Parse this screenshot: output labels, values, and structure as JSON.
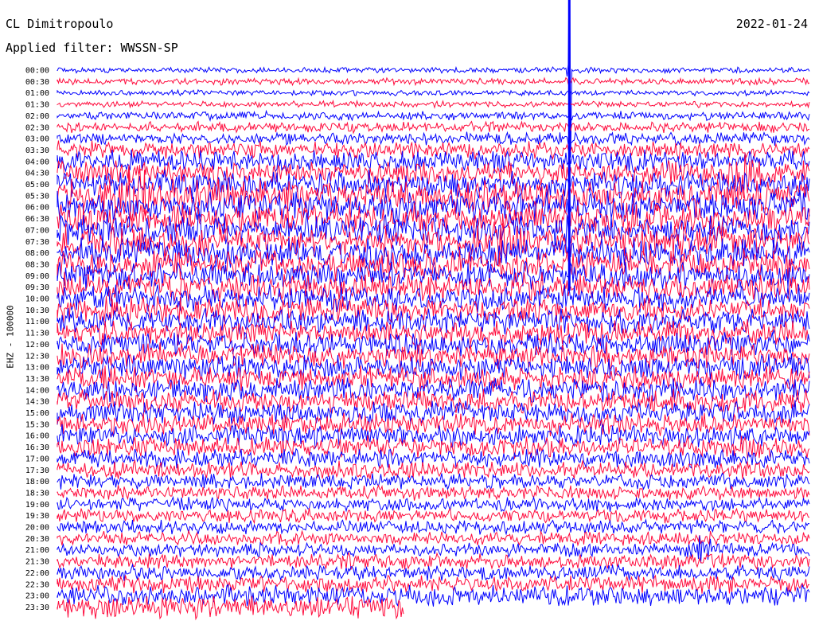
{
  "header": {
    "station": "CL Dimitropoulo",
    "filter": "Applied filter: WWSSN-SP",
    "date": "2022-01-24"
  },
  "chart_data": {
    "type": "line",
    "title": "CL Dimitropoulo",
    "subtitle": "Applied filter: WWSSN-SP",
    "date": "2022-01-24",
    "ylabel": "EHZ - 100000",
    "row_labels": [
      "00:00",
      "00:30",
      "01:00",
      "01:30",
      "02:00",
      "02:30",
      "03:00",
      "03:30",
      "04:00",
      "04:30",
      "05:00",
      "05:30",
      "06:00",
      "06:30",
      "07:00",
      "07:30",
      "08:00",
      "08:30",
      "09:00",
      "09:30",
      "10:00",
      "10:30",
      "11:00",
      "11:30",
      "12:00",
      "12:30",
      "13:00",
      "13:30",
      "14:00",
      "14:30",
      "15:00",
      "15:30",
      "16:00",
      "16:30",
      "17:00",
      "17:30",
      "18:00",
      "18:30",
      "19:00",
      "19:30",
      "20:00",
      "20:30",
      "21:00",
      "21:30",
      "22:00",
      "22:30",
      "23:00",
      "23:30"
    ],
    "series_colors": [
      "#0000ff",
      "#ff0a3c"
    ],
    "relative_amplitude_per_row": [
      0.18,
      0.22,
      0.18,
      0.2,
      0.28,
      0.35,
      0.4,
      0.55,
      0.7,
      0.8,
      0.9,
      1.0,
      1.0,
      1.0,
      1.0,
      1.0,
      0.95,
      0.95,
      0.9,
      0.9,
      0.85,
      0.85,
      0.8,
      0.8,
      0.8,
      0.8,
      0.8,
      0.8,
      0.8,
      0.75,
      0.75,
      0.7,
      0.7,
      0.7,
      0.6,
      0.55,
      0.5,
      0.45,
      0.45,
      0.45,
      0.45,
      0.45,
      0.45,
      0.5,
      0.5,
      0.55,
      0.65,
      0.75
    ],
    "events": [
      {
        "row": 0,
        "time_fraction": 0.68,
        "kind": "spike"
      },
      {
        "row": 9,
        "time_fraction": 0.9,
        "kind": "burst"
      },
      {
        "row": 11,
        "time_fraction": 0.1,
        "kind": "burst"
      },
      {
        "row": 15,
        "time_fraction": 0.6,
        "kind": "burst"
      },
      {
        "row": 42,
        "time_fraction": 0.86,
        "kind": "burst"
      }
    ],
    "last_row_data_end_fraction": 0.46,
    "grid": false,
    "legend": "none"
  }
}
